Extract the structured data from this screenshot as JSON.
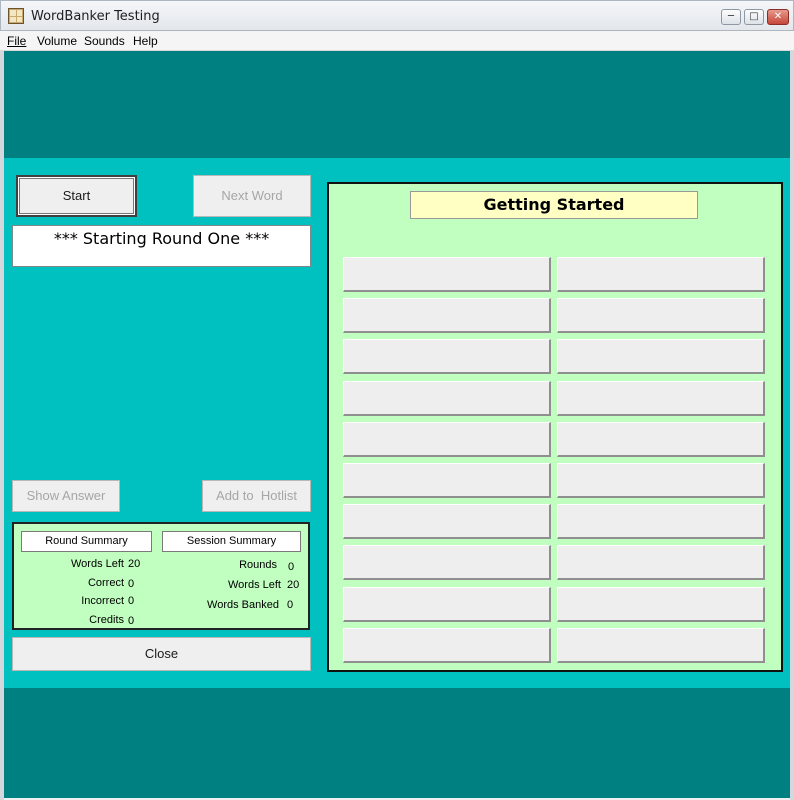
{
  "window": {
    "title": "WordBanker Testing"
  },
  "menu": {
    "items": [
      "File",
      "Volume",
      "Sounds",
      "Help"
    ]
  },
  "colors": {
    "band_dark": "#008080",
    "main_teal": "#00c0c0",
    "panel_green": "#c0ffc0",
    "title_yellow": "#ffffc4"
  },
  "controls": {
    "start_label": "Start",
    "next_word_label": "Next Word",
    "show_answer_label": "Show Answer",
    "add_hotlist_label": "Add to  Hotlist",
    "close_label": "Close"
  },
  "status_message": "*** Starting Round One ***",
  "round_summary": {
    "title": "Round Summary",
    "words_left_label": "Words Left",
    "words_left": "20",
    "correct_label": "Correct",
    "correct": "0",
    "incorrect_label": "Incorrect",
    "incorrect": "0",
    "credits_label": "Credits",
    "credits": "0"
  },
  "session_summary": {
    "title": "Session Summary",
    "rounds_label": "Rounds",
    "rounds": "0",
    "words_left_label": "Words Left",
    "words_left": "20",
    "words_banked_label": "Words Banked",
    "words_banked": "0"
  },
  "word_panel": {
    "title": "Getting Started",
    "slots": [
      "",
      "",
      "",
      "",
      "",
      "",
      "",
      "",
      "",
      "",
      "",
      "",
      "",
      "",
      "",
      "",
      "",
      "",
      "",
      ""
    ]
  },
  "icons": [
    "app-icon",
    "minimize-icon",
    "maximize-icon",
    "close-icon"
  ]
}
